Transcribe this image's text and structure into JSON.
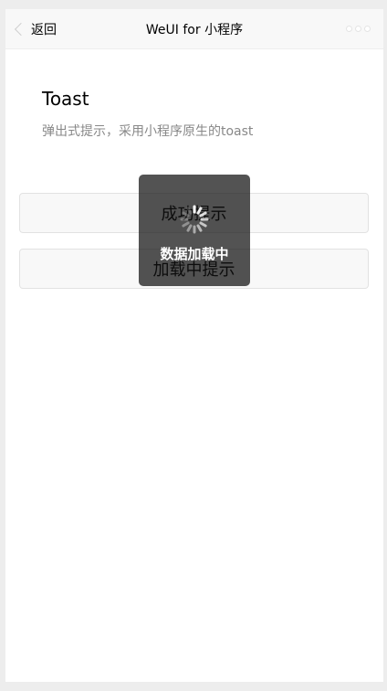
{
  "navbar": {
    "back_label": "返回",
    "title": "WeUI for 小程序"
  },
  "page": {
    "title": "Toast",
    "description": "弹出式提示，采用小程序原生的toast"
  },
  "buttons": {
    "success_label": "成功提示",
    "loading_label": "加载中提示"
  },
  "toast": {
    "text": "数据加载中",
    "icon": "loading-spinner-icon"
  }
}
